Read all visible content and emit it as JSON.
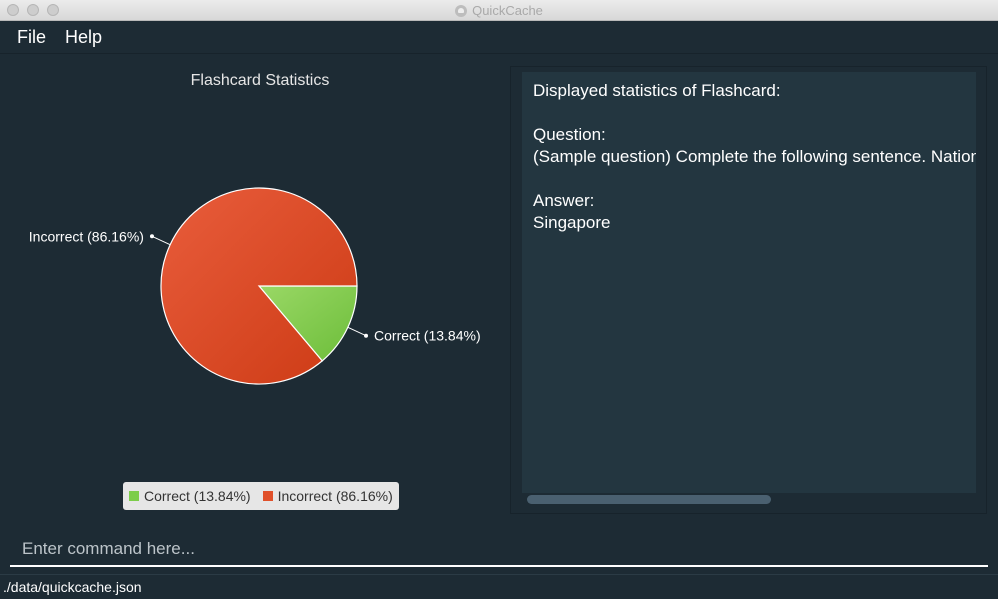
{
  "window": {
    "title": "QuickCache"
  },
  "menu": {
    "items": [
      {
        "label": "File"
      },
      {
        "label": "Help"
      }
    ]
  },
  "chart": {
    "title": "Flashcard Statistics",
    "slice_labels": {
      "correct": "Correct (13.84%)",
      "incorrect": "Incorrect (86.16%)"
    },
    "legend": [
      {
        "label": "Correct (13.84%)",
        "color": "#7ccd4a"
      },
      {
        "label": "Incorrect (86.16%)",
        "color": "#e0502a"
      }
    ]
  },
  "chart_data": {
    "type": "pie",
    "title": "Flashcard Statistics",
    "slices": [
      {
        "label": "Correct",
        "value": 13.84,
        "color": "#7ccd4a"
      },
      {
        "label": "Incorrect",
        "value": 86.16,
        "color": "#e0502a"
      }
    ],
    "legend_position": "bottom"
  },
  "details": {
    "heading": "Displayed statistics of Flashcard:",
    "question_label": "Question:",
    "question_text": "(Sample question) Complete the following sentence. National",
    "answer_label": "Answer:",
    "answer_text": "Singapore"
  },
  "command": {
    "placeholder": "Enter command here...",
    "value": ""
  },
  "status": {
    "path": "./data/quickcache.json"
  }
}
